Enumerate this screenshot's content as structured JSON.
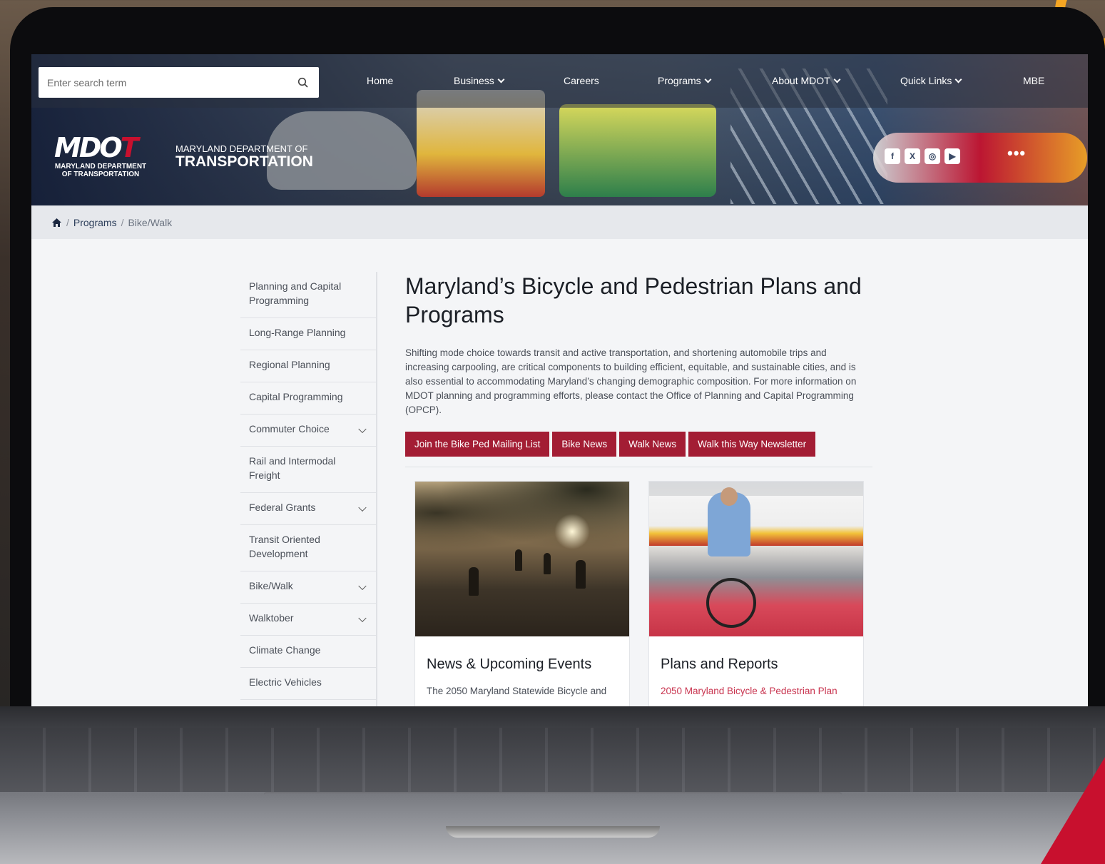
{
  "search": {
    "placeholder": "Enter search term"
  },
  "nav": {
    "home": "Home",
    "business": "Business",
    "careers": "Careers",
    "programs": "Programs",
    "about": "About MDOT",
    "quick_links": "Quick Links",
    "mbe": "MBE"
  },
  "brand": {
    "logo_text": "MDOT",
    "logo_sub_line1": "MARYLAND DEPARTMENT",
    "logo_sub_line2": "OF TRANSPORTATION",
    "agency_line1": "MARYLAND DEPARTMENT OF",
    "agency_line2": "TRANSPORTATION",
    "accent": "#c8102e"
  },
  "social": {
    "icons": [
      "facebook-icon",
      "x-icon",
      "instagram-icon",
      "youtube-icon"
    ],
    "more": "•••"
  },
  "breadcrumb": {
    "programs": "Programs",
    "current": "Bike/Walk",
    "sep": "/"
  },
  "sidebar": {
    "items": [
      {
        "label": "Planning and Capital Programming",
        "expandable": false
      },
      {
        "label": "Long-Range Planning",
        "expandable": false
      },
      {
        "label": "Regional Planning",
        "expandable": false
      },
      {
        "label": "Capital Programming",
        "expandable": false
      },
      {
        "label": "Commuter Choice",
        "expandable": true
      },
      {
        "label": "Rail and Intermodal Freight",
        "expandable": false
      },
      {
        "label": "Federal Grants",
        "expandable": true
      },
      {
        "label": "Transit Oriented Development",
        "expandable": false
      },
      {
        "label": "Bike/Walk",
        "expandable": true
      },
      {
        "label": "Walktober",
        "expandable": true
      },
      {
        "label": "Climate Change",
        "expandable": false
      },
      {
        "label": "Electric Vehicles",
        "expandable": false
      }
    ]
  },
  "main": {
    "title": "Maryland’s Bicycle and Pedestrian Plans and Programs",
    "intro": "Shifting mode choice towards transit and active transportation, and shortening automobile trips and increasing carpooling, are critical components to building efficient, equitable, and sustainable cities, and is also essential to accommodating Maryland’s changing demographic composition. For more information on MDOT planning and programming efforts, please contact the Office of Planning and Capital Programming (OPCP).",
    "buttons": {
      "mailing": "Join the Bike Ped Mailing List",
      "bike_news": "Bike News",
      "walk_news": "Walk News",
      "newsletter": "Walk this Way Newsletter"
    },
    "button_color": "#a31d34"
  },
  "cards": [
    {
      "title": "News & Upcoming Events",
      "text": "The 2050 Maryland Statewide Bicycle and"
    },
    {
      "title": "Plans and Reports",
      "text": "2050 Maryland Bicycle & Pedestrian Plan"
    }
  ]
}
